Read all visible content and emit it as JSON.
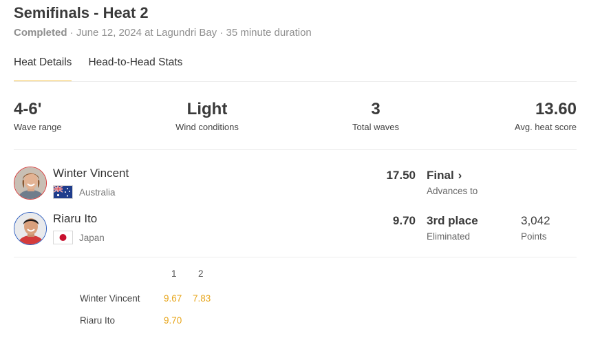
{
  "header": {
    "title": "Semifinals - Heat 2",
    "status": "Completed",
    "details": " · June 12, 2024 at Lagundri Bay · 35 minute duration"
  },
  "tabs": [
    {
      "label": "Heat Details",
      "active": true
    },
    {
      "label": "Head-to-Head Stats",
      "active": false
    }
  ],
  "stats": [
    {
      "value": "4-6'",
      "label": "Wave range"
    },
    {
      "value": "Light",
      "label": "Wind conditions"
    },
    {
      "value": "3",
      "label": "Total waves"
    },
    {
      "value": "13.60",
      "label": "Avg. heat score"
    }
  ],
  "athletes": [
    {
      "name": "Winter Vincent",
      "country": "Australia",
      "flag_icon": "australia-flag-icon",
      "score": "17.50",
      "result": "Final",
      "result_sub": "Advances to",
      "result_icon": "chevron-right-icon"
    },
    {
      "name": "Riaru Ito",
      "country": "Japan",
      "flag_icon": "japan-flag-icon",
      "score": "9.70",
      "result": "3rd place",
      "result_sub": "Eliminated",
      "points_value": "3,042",
      "points_label": "Points"
    }
  ],
  "waves": {
    "headers": [
      "1",
      "2"
    ],
    "rows": [
      {
        "name": "Winter Vincent",
        "scores": [
          "9.67",
          "7.83"
        ]
      },
      {
        "name": "Riaru Ito",
        "scores": [
          "9.70"
        ]
      }
    ]
  },
  "colors": {
    "accent": "#f5c242",
    "wave_score": "#e7a51a",
    "red_border": "#d33a3a",
    "blue_border": "#2f5fbf"
  }
}
